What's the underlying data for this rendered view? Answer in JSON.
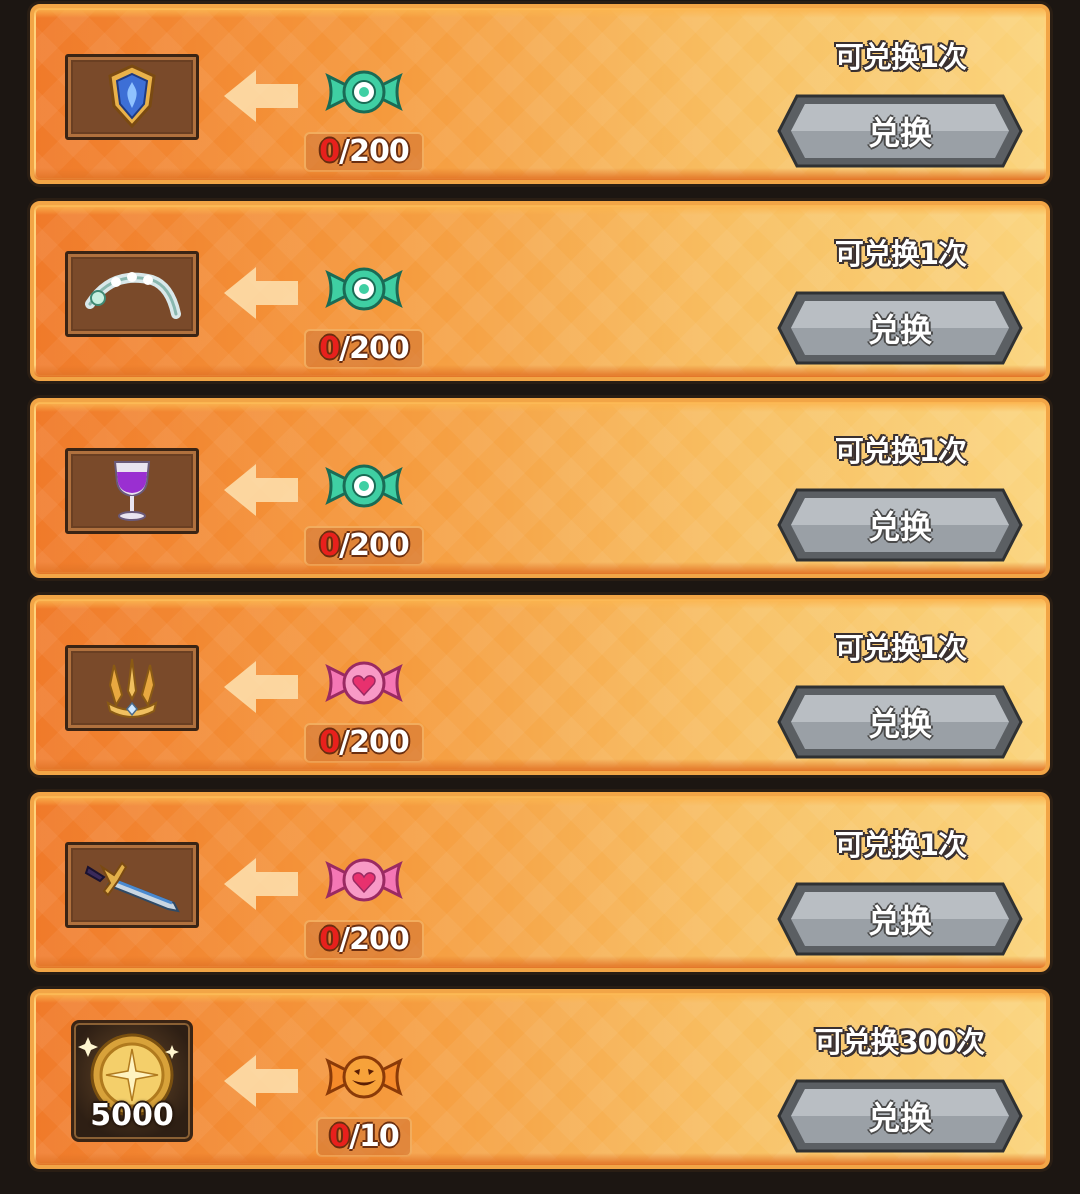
{
  "exchange_button_label": "兑换",
  "rows": [
    {
      "reward": "blue-crest-emblem",
      "candy": "green-candy",
      "candy_color": "#3fcfa3",
      "progress_current": "0",
      "progress_total": "/200",
      "limit_text": "可兑换1次"
    },
    {
      "reward": "pearl-flower-headband",
      "candy": "green-candy",
      "candy_color": "#3fcfa3",
      "progress_current": "0",
      "progress_total": "/200",
      "limit_text": "可兑换1次"
    },
    {
      "reward": "purple-wine-goblet",
      "candy": "green-candy",
      "candy_color": "#3fcfa3",
      "progress_current": "0",
      "progress_total": "/200",
      "limit_text": "可兑换1次"
    },
    {
      "reward": "golden-crown",
      "candy": "pink-heart-candy",
      "candy_color": "#f577b5",
      "progress_current": "0",
      "progress_total": "/200",
      "limit_text": "可兑换1次"
    },
    {
      "reward": "steel-sword",
      "candy": "pink-heart-candy",
      "candy_color": "#f577b5",
      "progress_current": "0",
      "progress_total": "/200",
      "limit_text": "可兑换1次"
    },
    {
      "reward": "gold-coin",
      "reward_amount": "5000",
      "candy": "pumpkin-candy",
      "candy_color": "#f58a2a",
      "progress_current": "0",
      "progress_total": "/10",
      "limit_text": "可兑换300次"
    }
  ]
}
